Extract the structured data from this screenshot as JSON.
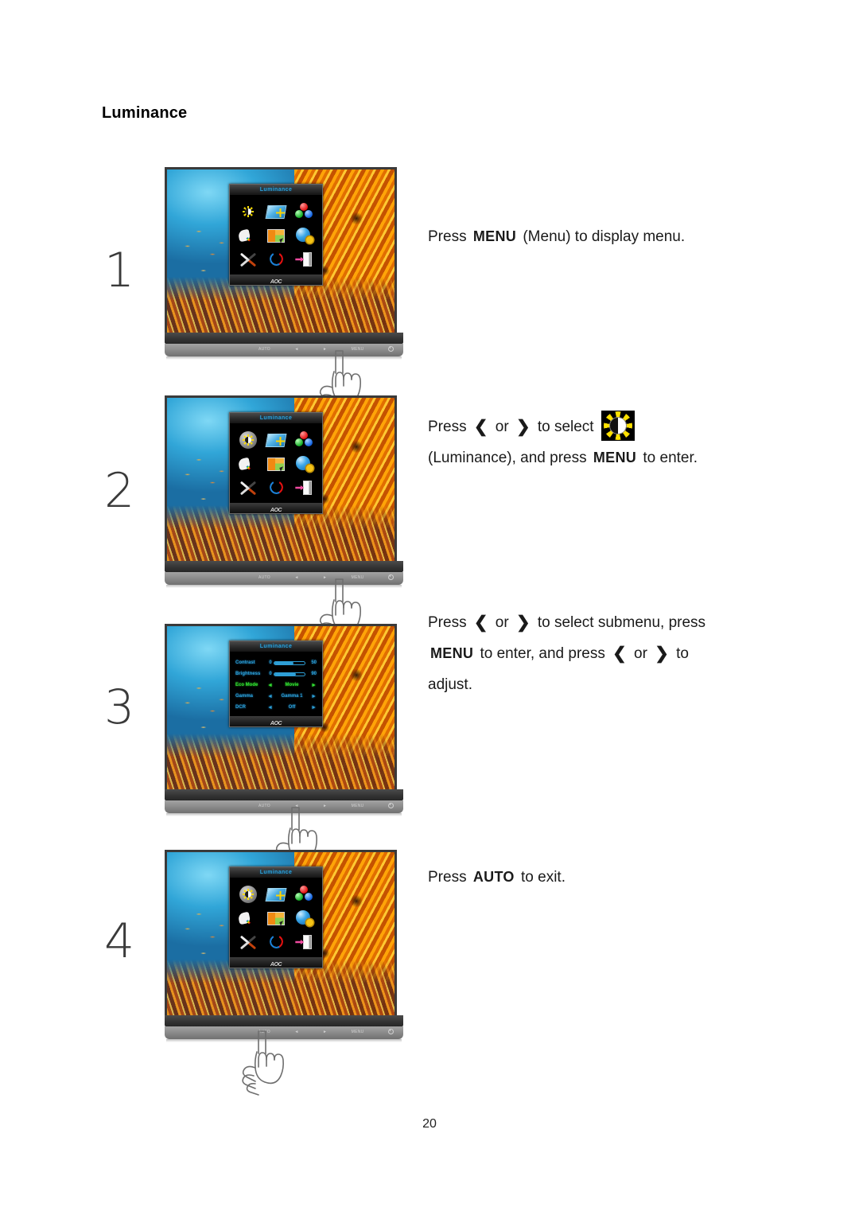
{
  "document": {
    "section_title": "Luminance",
    "page_number": "20"
  },
  "keys": {
    "menu": "MENU",
    "auto": "AUTO",
    "left": "❮",
    "right": "❯"
  },
  "steps": [
    {
      "number": "1",
      "text_lines": [
        {
          "parts": [
            {
              "type": "text",
              "value": "Press"
            },
            {
              "type": "key",
              "value": "MENU"
            },
            {
              "type": "text",
              "value": "(Menu) to display menu."
            }
          ]
        }
      ]
    },
    {
      "number": "2",
      "text_lines": [
        {
          "parts": [
            {
              "type": "text",
              "value": "Press"
            },
            {
              "type": "chev",
              "value": "❮"
            },
            {
              "type": "text",
              "value": "or"
            },
            {
              "type": "chev",
              "value": "❯"
            },
            {
              "type": "text",
              "value": "to select"
            },
            {
              "type": "icon",
              "value": "luminance-icon"
            }
          ]
        },
        {
          "parts": [
            {
              "type": "text",
              "value": "(Luminance), and press"
            },
            {
              "type": "key",
              "value": "MENU"
            },
            {
              "type": "text",
              "value": "to enter."
            }
          ]
        }
      ]
    },
    {
      "number": "3",
      "text_lines": [
        {
          "parts": [
            {
              "type": "text",
              "value": "Press"
            },
            {
              "type": "chev",
              "value": "❮"
            },
            {
              "type": "text",
              "value": "or"
            },
            {
              "type": "chev",
              "value": "❯"
            },
            {
              "type": "text",
              "value": "to select submenu, press"
            }
          ]
        },
        {
          "parts": [
            {
              "type": "key",
              "value": "MENU"
            },
            {
              "type": "text",
              "value": "to enter, and press"
            },
            {
              "type": "chev",
              "value": "❮"
            },
            {
              "type": "text",
              "value": "or"
            },
            {
              "type": "chev",
              "value": "❯"
            },
            {
              "type": "text",
              "value": "to"
            }
          ]
        },
        {
          "parts": [
            {
              "type": "text",
              "value": "adjust."
            }
          ]
        }
      ]
    },
    {
      "number": "4",
      "text_lines": [
        {
          "parts": [
            {
              "type": "text",
              "value": "Press"
            },
            {
              "type": "key",
              "value": "AUTO"
            },
            {
              "type": "text",
              "value": "to exit."
            }
          ]
        }
      ]
    }
  ],
  "monitor": {
    "brand_logo": "AOC",
    "buttons": [
      "AUTO",
      "◄",
      "►",
      "MENU"
    ],
    "power_button": "power-icon"
  },
  "osd_main": {
    "title": "Luminance",
    "icons": [
      {
        "name": "luminance-icon",
        "label": "Luminance",
        "selected": true
      },
      {
        "name": "image-setup-icon",
        "label": "Image Setup",
        "selected": false
      },
      {
        "name": "color-setup-icon",
        "label": "Color Setup",
        "selected": false
      },
      {
        "name": "picture-boost-icon",
        "label": "Picture Boost",
        "selected": false
      },
      {
        "name": "osd-setup-icon",
        "label": "OSD Setup",
        "selected": false
      },
      {
        "name": "extra-icon",
        "label": "Extra",
        "selected": false
      },
      {
        "name": "reset-tools-icon",
        "label": "Reset",
        "selected": false
      },
      {
        "name": "refresh-loop-icon",
        "label": "Refresh",
        "selected": false
      },
      {
        "name": "exit-icon",
        "label": "Exit",
        "selected": false
      }
    ]
  },
  "osd_submenu": {
    "title": "Luminance",
    "rows": [
      {
        "label": "Contrast",
        "type": "slider",
        "min": "0",
        "max": "50",
        "fill_pct": 62,
        "selected": false
      },
      {
        "label": "Brightness",
        "type": "slider",
        "min": "0",
        "max": "90",
        "fill_pct": 70,
        "selected": false
      },
      {
        "label": "Eco Mode",
        "type": "option",
        "value": "Movie",
        "selected": true
      },
      {
        "label": "Gamma",
        "type": "option",
        "value": "Gamma 1",
        "selected": false
      },
      {
        "label": "DCR",
        "type": "option",
        "value": "Off",
        "selected": false
      }
    ]
  }
}
